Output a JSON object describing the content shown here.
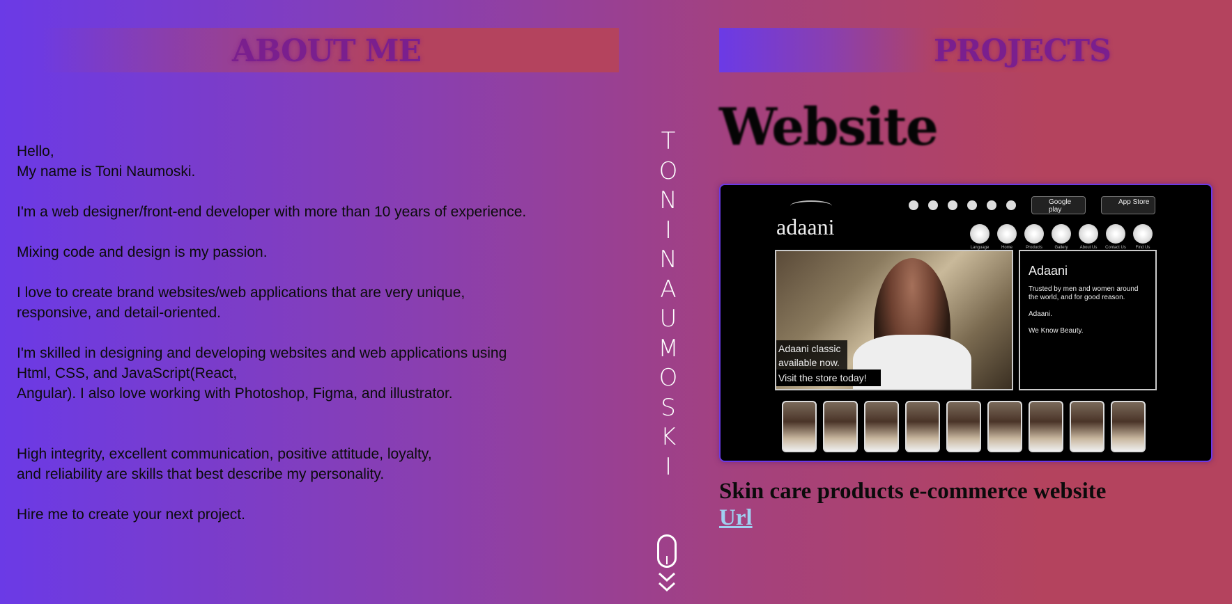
{
  "about": {
    "heading": "ABOUT ME",
    "paragraphs": [
      "Hello,\nMy name is Toni Naumoski.",
      "I'm a web designer/front-end developer with more than 10 years of experience.",
      "Mixing code and design is my passion.",
      "I love to create brand websites/web applications that are very unique,\nresponsive, and detail-oriented.",
      "I'm skilled in designing and developing websites and web applications using\nHtml, CSS, and JavaScript(React,\nAngular). I also love working with Photoshop, Figma, and illustrator.",
      "High integrity, excellent communication, positive attitude, loyalty,\nand reliability are skills that best describe my personality.",
      "Hire me to create your next project."
    ]
  },
  "vertical_name": [
    "T",
    "O",
    "N",
    "I",
    "N",
    "A",
    "U",
    "M",
    "O",
    "S",
    "K",
    "I"
  ],
  "scroll_indicator": {
    "icon": "mouse-scroll-icon",
    "arrows": "chevron-double-down-icon"
  },
  "projects": {
    "heading": "PROJECTS",
    "category_title": "Website",
    "items": [
      {
        "description": "Skin care products e-commerce website",
        "link_label": "Url",
        "screenshot": {
          "logo": "adaani",
          "store_buttons": [
            "Google play",
            "App Store"
          ],
          "store_button_subs": [
            "Get it on",
            "Available on the"
          ],
          "nav_labels": [
            "Language",
            "Home",
            "Products",
            "Gallery",
            "About Us",
            "Contact Us",
            "Find Us"
          ],
          "hero_caption_lines": [
            "Adaani classic",
            "available now.",
            "Visit the store today!"
          ],
          "info_title": "Adaani",
          "info_lines": [
            "Trusted by men and women around the world, and for good reason.",
            "Adaani.",
            "We Know Beauty."
          ]
        }
      }
    ]
  },
  "colors": {
    "gradient_left": "#6b3ae6",
    "gradient_right": "#b4435e",
    "heading_text": "#7a1f8e",
    "link": "#9fd0f0"
  }
}
